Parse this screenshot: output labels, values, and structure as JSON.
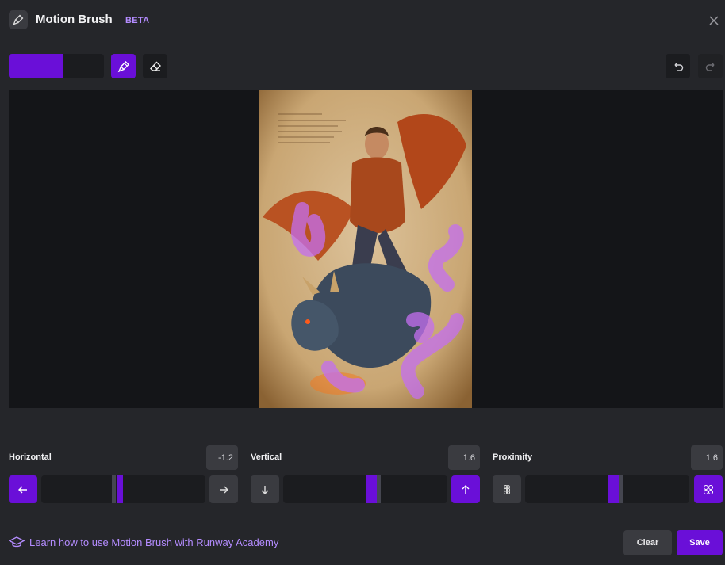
{
  "header": {
    "title": "Motion Brush",
    "badge": "BETA"
  },
  "toolbar": {
    "brush_size_fraction": 0.57
  },
  "controls": {
    "horizontal": {
      "label": "Horizontal",
      "value": "-1.2"
    },
    "vertical": {
      "label": "Vertical",
      "value": "1.6"
    },
    "proximity": {
      "label": "Proximity",
      "value": "1.6"
    }
  },
  "footer": {
    "learn_link": "Learn how to use Motion Brush with Runway Academy",
    "clear_label": "Clear",
    "save_label": "Save"
  },
  "colors": {
    "accent": "#6a0fd8",
    "link": "#b48cff",
    "background": "#25262a"
  }
}
